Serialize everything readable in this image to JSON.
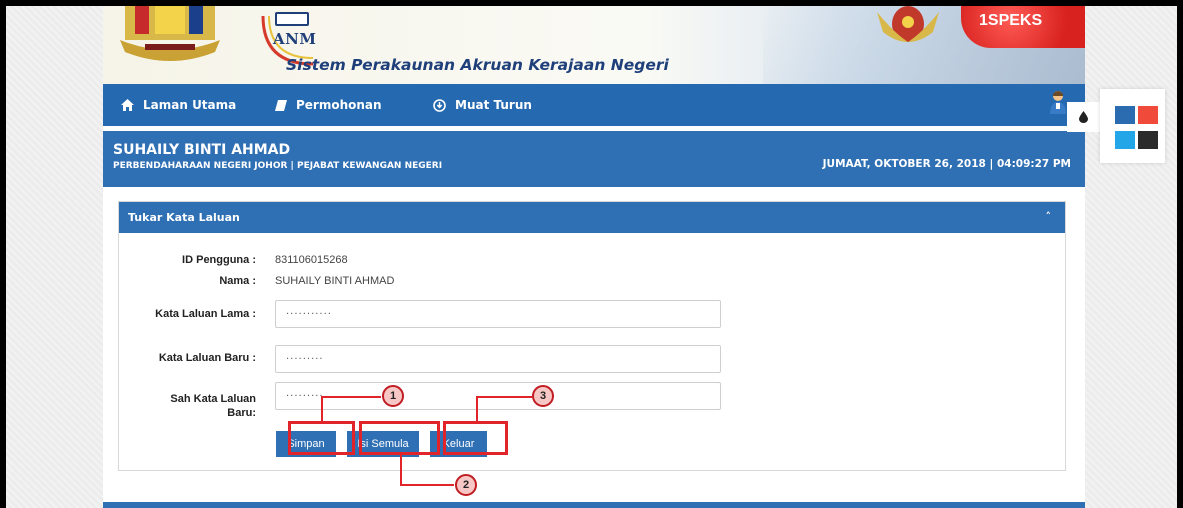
{
  "banner": {
    "agency_short": "ANM",
    "system_title": "Sistem Perakaunan Akruan Kerajaan Negeri",
    "brand": "1SPEKS"
  },
  "nav": {
    "items": [
      {
        "label": "Laman Utama",
        "icon": "home-icon"
      },
      {
        "label": "Permohonan",
        "icon": "book-icon"
      },
      {
        "label": "Muat Turun",
        "icon": "download-icon"
      }
    ],
    "user_icon": "user-avatar-icon"
  },
  "user": {
    "name": "SUHAILY BINTI AHMAD",
    "organization": "PERBENDAHARAAN NEGERI JOHOR | PEJABAT KEWANGAN NEGERI",
    "datetime": "JUMAAT, OKTOBER 26, 2018 | 04:09:27 PM"
  },
  "panel": {
    "title": "Tukar Kata Laluan",
    "collapse_icon": "chevron-up-icon"
  },
  "form": {
    "user_id_label": "ID Pengguna :",
    "user_id_value": "831106015268",
    "name_label": "Nama :",
    "name_value": "SUHAILY BINTI AHMAD",
    "old_password_label": "Kata Laluan Lama :",
    "old_password_value": "···········",
    "new_password_label": "Kata Laluan Baru :",
    "new_password_value": "·········",
    "confirm_password_label_1": "Sah Kata Laluan",
    "confirm_password_label_2": "Baru:",
    "confirm_password_value": "·········"
  },
  "buttons": {
    "save": "Simpan",
    "reset": "Isi Semula",
    "exit": "Keluar"
  },
  "callouts": [
    "1",
    "2",
    "3"
  ],
  "theme": {
    "swatches": [
      "#2b6cb0",
      "#f04a3a",
      "#22a6e8",
      "#2b2b2b"
    ]
  },
  "colors": {
    "nav_blue": "#2569b0",
    "panel_blue": "#2f6fb4",
    "highlight_red": "#e1242a"
  }
}
